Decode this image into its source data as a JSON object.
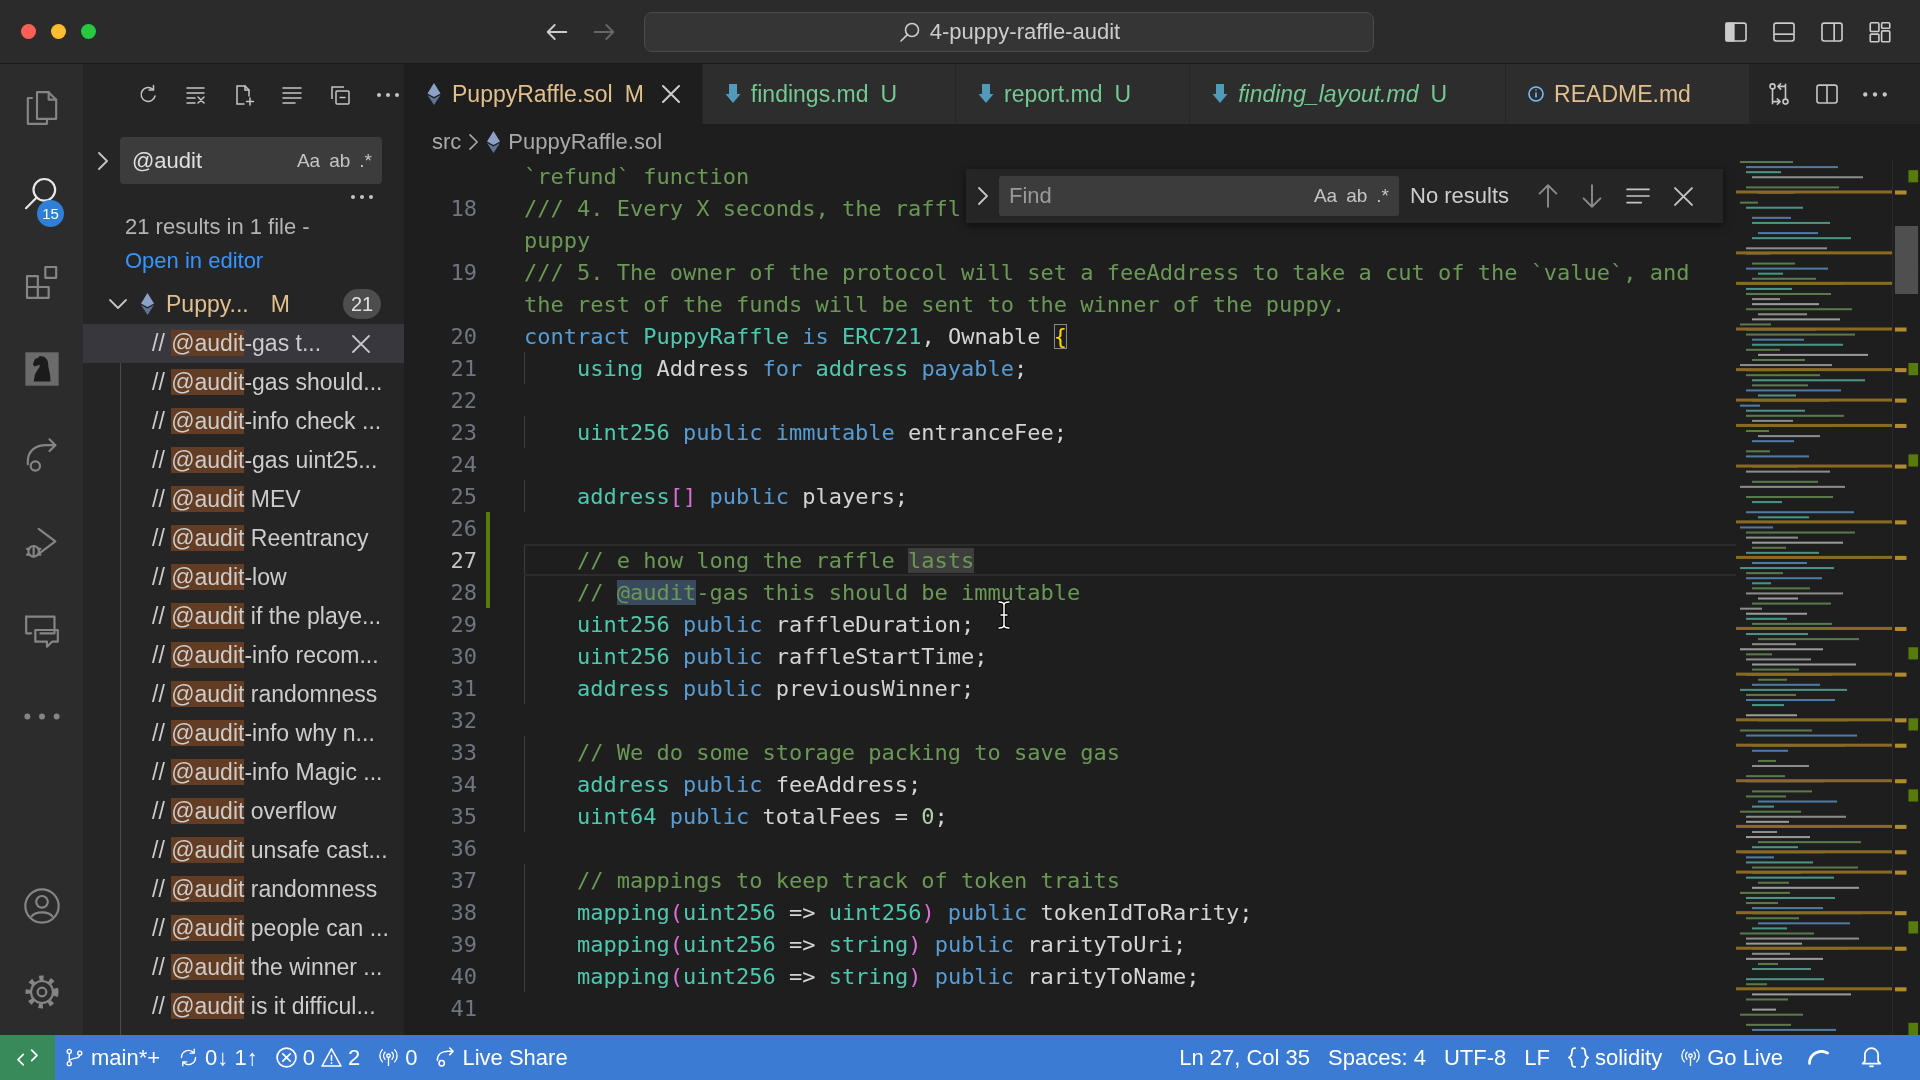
{
  "window": {
    "title": "4-puppy-raffle-audit",
    "nav": [
      {
        "disabled": false
      },
      {
        "disabled": true
      }
    ],
    "layout": [
      {
        "on": true
      },
      {
        "on": false
      },
      {
        "on": false
      }
    ]
  },
  "activity_bar": {
    "items": [
      {
        "selected": false
      },
      {
        "selected": true,
        "badge": "15"
      },
      {
        "selected": false
      },
      {
        "selected": false
      },
      {
        "selected": false
      },
      {
        "selected": false
      },
      {
        "selected": false
      }
    ]
  },
  "sidebar": {
    "search": {
      "value": "@audit",
      "options": [
        "Aa",
        "ab",
        ".*"
      ]
    },
    "summary": "21 results in 1 file -",
    "link": "Open in editor",
    "file": {
      "name": "Puppy...",
      "untracked": false,
      "status": "M",
      "count": "21",
      "expanded": true
    },
    "results": [
      {
        "prefix": "// ",
        "match": "@audit",
        "rest": "-gas t...",
        "selected": true
      },
      {
        "prefix": "// ",
        "match": "@audit",
        "rest": "-gas should...",
        "selected": false
      },
      {
        "prefix": "// ",
        "match": "@audit",
        "rest": "-info check ...",
        "selected": false
      },
      {
        "prefix": "// ",
        "match": "@audit",
        "rest": "-gas uint25...",
        "selected": false
      },
      {
        "prefix": "// ",
        "match": "@audit",
        "rest": " MEV",
        "selected": false
      },
      {
        "prefix": "// ",
        "match": "@audit",
        "rest": " Reentrancy",
        "selected": false
      },
      {
        "prefix": "// ",
        "match": "@audit",
        "rest": "-low",
        "selected": false
      },
      {
        "prefix": "// ",
        "match": "@audit",
        "rest": " if the playe...",
        "selected": false
      },
      {
        "prefix": "// ",
        "match": "@audit",
        "rest": "-info recom...",
        "selected": false
      },
      {
        "prefix": "// ",
        "match": "@audit",
        "rest": " randomness",
        "selected": false
      },
      {
        "prefix": "// ",
        "match": "@audit",
        "rest": "-info why n...",
        "selected": false
      },
      {
        "prefix": "// ",
        "match": "@audit",
        "rest": "-info Magic ...",
        "selected": false
      },
      {
        "prefix": "// ",
        "match": "@audit",
        "rest": " overflow",
        "selected": false
      },
      {
        "prefix": "// ",
        "match": "@audit",
        "rest": " unsafe cast...",
        "selected": false
      },
      {
        "prefix": "// ",
        "match": "@audit",
        "rest": " randomness",
        "selected": false
      },
      {
        "prefix": "// ",
        "match": "@audit",
        "rest": " people can ...",
        "selected": false
      },
      {
        "prefix": "// ",
        "match": "@audit",
        "rest": " the winner ...",
        "selected": false
      },
      {
        "prefix": "// ",
        "match": "@audit",
        "rest": " is it difficul...",
        "selected": false
      }
    ]
  },
  "editor": {
    "tabs": [
      {
        "label": "PuppyRaffle.sol",
        "kind": "solidity",
        "untracked": false,
        "status": "M",
        "italic": false,
        "selected": true
      },
      {
        "label": "findings.md",
        "kind": "markdown",
        "untracked": true,
        "status": "U",
        "italic": false,
        "selected": false
      },
      {
        "label": "report.md",
        "kind": "markdown",
        "untracked": true,
        "status": "U",
        "italic": false,
        "selected": false
      },
      {
        "label": "finding_layout.md",
        "kind": "markdown",
        "untracked": true,
        "status": "U",
        "italic": true,
        "selected": false
      },
      {
        "label": "README.md",
        "kind": "info",
        "untracked": false,
        "italic": false,
        "selected": false
      }
    ],
    "breadcrumb": [
      {
        "label": "src",
        "kind": "folder"
      },
      {
        "label": "PuppyRaffle.sol",
        "kind": "solidity"
      }
    ],
    "find": {
      "placeholder": "Find",
      "options": [
        "Aa",
        "ab",
        ".*"
      ],
      "status": "No results"
    },
    "lines": [
      {
        "current": false,
        "added": false,
        "rows": [
          {
            "tokens": [
              {
                "text": "`refund` function",
                "kind": "comment"
              }
            ]
          }
        ]
      },
      {
        "number": "18",
        "current": false,
        "added": false,
        "rows": [
          {
            "tokens": [
              {
                "text": "/// 4. Every X seconds, the raffl",
                "kind": "comment"
              }
            ]
          },
          {
            "tokens": [
              {
                "text": "puppy",
                "kind": "comment"
              }
            ]
          }
        ]
      },
      {
        "number": "19",
        "current": false,
        "added": false,
        "rows": [
          {
            "tokens": [
              {
                "text": "/// 5. The owner of the protocol will set a feeAddress to take a cut of the `value`, and",
                "kind": "comment"
              }
            ]
          },
          {
            "tokens": [
              {
                "text": "the rest of the funds will be sent to the winner of the puppy.",
                "kind": "comment"
              }
            ]
          }
        ]
      },
      {
        "number": "20",
        "current": false,
        "added": false,
        "rows": [
          {
            "tokens": [
              {
                "text": "contract ",
                "kind": "keyword"
              },
              {
                "text": "PuppyRaffle ",
                "kind": "type"
              },
              {
                "text": "is ",
                "kind": "keyword"
              },
              {
                "text": "ERC721",
                "kind": "type"
              },
              {
                "text": ", Ownable ",
                "kind": "plain"
              },
              {
                "text": "{",
                "kind": "bracket-match"
              }
            ]
          }
        ]
      },
      {
        "number": "21",
        "current": false,
        "added": false,
        "rows": [
          {
            "tokens": [
              {
                "text": "    using ",
                "kind": "type"
              },
              {
                "text": "Address ",
                "kind": "plain"
              },
              {
                "text": "for ",
                "kind": "keyword"
              },
              {
                "text": "address ",
                "kind": "type"
              },
              {
                "text": "payable",
                "kind": "keyword"
              },
              {
                "text": ";",
                "kind": "plain"
              }
            ]
          }
        ]
      },
      {
        "number": "22",
        "current": false,
        "added": false
      },
      {
        "number": "23",
        "current": false,
        "added": false,
        "rows": [
          {
            "tokens": [
              {
                "text": "    uint256 ",
                "kind": "type"
              },
              {
                "text": "public immutable ",
                "kind": "keyword"
              },
              {
                "text": "entranceFee;",
                "kind": "plain"
              }
            ]
          }
        ]
      },
      {
        "number": "24",
        "current": false,
        "added": false
      },
      {
        "number": "25",
        "current": false,
        "added": false,
        "rows": [
          {
            "tokens": [
              {
                "text": "    address",
                "kind": "type"
              },
              {
                "text": "[]",
                "kind": "bracket2"
              },
              {
                "text": " public ",
                "kind": "keyword"
              },
              {
                "text": "players;",
                "kind": "plain"
              }
            ]
          }
        ]
      },
      {
        "number": "26",
        "current": false,
        "added": true
      },
      {
        "number": "27",
        "current": true,
        "added": true,
        "rows": [
          {
            "tokens": [
              {
                "text": "    // e how long the raffle ",
                "kind": "comment"
              },
              {
                "text": "lasts",
                "kind": "occurrence"
              }
            ]
          }
        ]
      },
      {
        "number": "28",
        "current": false,
        "added": true,
        "rows": [
          {
            "tokens": [
              {
                "text": "    // ",
                "kind": "comment"
              },
              {
                "text": "@audit",
                "kind": "selection"
              },
              {
                "text": "-gas this should be immutable",
                "kind": "comment"
              }
            ]
          }
        ]
      },
      {
        "number": "29",
        "current": false,
        "added": false,
        "rows": [
          {
            "tokens": [
              {
                "text": "    uint256 ",
                "kind": "type"
              },
              {
                "text": "public ",
                "kind": "keyword"
              },
              {
                "text": "raffleDuration;",
                "kind": "plain"
              }
            ]
          }
        ]
      },
      {
        "number": "30",
        "current": false,
        "added": false,
        "rows": [
          {
            "tokens": [
              {
                "text": "    uint256 ",
                "kind": "type"
              },
              {
                "text": "public ",
                "kind": "keyword"
              },
              {
                "text": "raffleStartTime;",
                "kind": "plain"
              }
            ]
          }
        ]
      },
      {
        "number": "31",
        "current": false,
        "added": false,
        "rows": [
          {
            "tokens": [
              {
                "text": "    address ",
                "kind": "type"
              },
              {
                "text": "public ",
                "kind": "keyword"
              },
              {
                "text": "previousWinner;",
                "kind": "plain"
              }
            ]
          }
        ]
      },
      {
        "number": "32",
        "current": false,
        "added": false
      },
      {
        "number": "33",
        "current": false,
        "added": false,
        "rows": [
          {
            "tokens": [
              {
                "text": "    // We do some storage packing to save gas",
                "kind": "comment"
              }
            ]
          }
        ]
      },
      {
        "number": "34",
        "current": false,
        "added": false,
        "rows": [
          {
            "tokens": [
              {
                "text": "    address ",
                "kind": "type"
              },
              {
                "text": "public ",
                "kind": "keyword"
              },
              {
                "text": "feeAddress;",
                "kind": "plain"
              }
            ]
          }
        ]
      },
      {
        "number": "35",
        "current": false,
        "added": false,
        "rows": [
          {
            "tokens": [
              {
                "text": "    uint64 ",
                "kind": "type"
              },
              {
                "text": "public ",
                "kind": "keyword"
              },
              {
                "text": "totalFees = ",
                "kind": "plain"
              },
              {
                "text": "0",
                "kind": "number"
              },
              {
                "text": ";",
                "kind": "plain"
              }
            ]
          }
        ]
      },
      {
        "number": "36",
        "current": false,
        "added": false
      },
      {
        "number": "37",
        "current": false,
        "added": false,
        "rows": [
          {
            "tokens": [
              {
                "text": "    // mappings to keep track of token traits",
                "kind": "comment"
              }
            ]
          }
        ]
      },
      {
        "number": "38",
        "current": false,
        "added": false,
        "rows": [
          {
            "tokens": [
              {
                "text": "    mapping",
                "kind": "type"
              },
              {
                "text": "(",
                "kind": "bracket2"
              },
              {
                "text": "uint256 ",
                "kind": "type"
              },
              {
                "text": "=> ",
                "kind": "plain"
              },
              {
                "text": "uint256",
                "kind": "type"
              },
              {
                "text": ")",
                "kind": "bracket2"
              },
              {
                "text": " public ",
                "kind": "keyword"
              },
              {
                "text": "tokenIdToRarity;",
                "kind": "plain"
              }
            ]
          }
        ]
      },
      {
        "number": "39",
        "current": false,
        "added": false,
        "rows": [
          {
            "tokens": [
              {
                "text": "    mapping",
                "kind": "type"
              },
              {
                "text": "(",
                "kind": "bracket2"
              },
              {
                "text": "uint256 ",
                "kind": "type"
              },
              {
                "text": "=> ",
                "kind": "plain"
              },
              {
                "text": "string",
                "kind": "type"
              },
              {
                "text": ")",
                "kind": "bracket2"
              },
              {
                "text": " public ",
                "kind": "keyword"
              },
              {
                "text": "rarityToUri;",
                "kind": "plain"
              }
            ]
          }
        ]
      },
      {
        "number": "40",
        "current": false,
        "added": false,
        "rows": [
          {
            "tokens": [
              {
                "text": "    mapping",
                "kind": "type"
              },
              {
                "text": "(",
                "kind": "bracket2"
              },
              {
                "text": "uint256 ",
                "kind": "type"
              },
              {
                "text": "=> ",
                "kind": "plain"
              },
              {
                "text": "string",
                "kind": "type"
              },
              {
                "text": ")",
                "kind": "bracket2"
              },
              {
                "text": " public ",
                "kind": "keyword"
              },
              {
                "text": "rarityToName;",
                "kind": "plain"
              }
            ]
          }
        ]
      },
      {
        "number": "41",
        "current": false,
        "added": false
      }
    ]
  },
  "status_bar": {
    "branch": "main*+",
    "sync": "0↓ 1↑",
    "errors": "0",
    "warnings": "2",
    "ports": "0",
    "live_share": "Live Share",
    "position": "Ln 27, Col 35",
    "indentation": "Spaces: 4",
    "encoding": "UTF-8",
    "eol": "LF",
    "language": "solidity",
    "go_live": "Go Live"
  }
}
